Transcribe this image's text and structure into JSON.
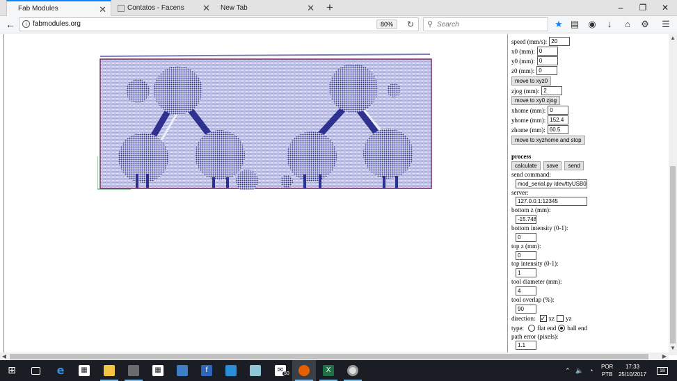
{
  "browser": {
    "tabs": [
      {
        "title": "Fab Modules",
        "active": true
      },
      {
        "title": "Contatos - Facens",
        "active": false
      },
      {
        "title": "New Tab",
        "active": false
      }
    ],
    "new_tab": "+",
    "window_controls": {
      "minimize": "–",
      "maximize": "❐",
      "close": "✕"
    },
    "url": "fabmodules.org",
    "zoom": "80%",
    "search_placeholder": "Search"
  },
  "panel": {
    "speed_label": "speed (mm/s):",
    "speed": "20",
    "x0_label": "x0 (mm):",
    "x0": "0",
    "y0_label": "y0 (mm):",
    "y0": "0",
    "z0_label": "z0 (mm):",
    "z0": "0",
    "move_xyz0": "move to xyz0",
    "zjog_label": "zjog (mm):",
    "zjog": "2",
    "move_xy0_zjog": "move to xy0 zjog",
    "xhome_label": "xhome (mm):",
    "xhome": "0",
    "yhome_label": "yhome (mm):",
    "yhome": "152.4",
    "zhome_label": "zhome (mm):",
    "zhome": "60.5",
    "move_xyzhome_stop": "move to xyzhome and stop",
    "process_heading": "process",
    "calculate": "calculate",
    "save": "save",
    "send": "send",
    "send_command_label": "send command:",
    "send_command": "mod_serial.py /dev/ttyUSB0",
    "server_label": "server:",
    "server": "127.0.0.1:12345",
    "bottom_z_label": "bottom z (mm):",
    "bottom_z": "-15.748",
    "bottom_intensity_label": "bottom intensity (0-1):",
    "bottom_intensity": "0",
    "top_z_label": "top z (mm):",
    "top_z": "0",
    "top_intensity_label": "top intensity (0-1):",
    "top_intensity": "1",
    "tool_diameter_label": "tool diameter (mm):",
    "tool_diameter": "4",
    "tool_overlap_label": "tool overlap (%):",
    "tool_overlap": "90",
    "direction_label": "direction:",
    "direction_xz": "xz",
    "direction_yz": "yz",
    "direction_xz_checked": true,
    "direction_yz_checked": false,
    "type_label": "type:",
    "type_flat": "flat end",
    "type_ball": "ball end",
    "type_selected": "ball end",
    "path_error_label": "path error (pixels):",
    "path_error": "1.1"
  },
  "taskbar": {
    "apps": [
      {
        "name": "start",
        "icon": "windows-icon"
      },
      {
        "name": "task-view",
        "icon": "task-view-icon"
      },
      {
        "name": "edge",
        "icon": "edge-icon"
      },
      {
        "name": "store",
        "icon": "store-icon"
      },
      {
        "name": "file-explorer",
        "icon": "folder-icon"
      },
      {
        "name": "app-5",
        "icon": "app-icon"
      },
      {
        "name": "calculator",
        "icon": "calculator-icon"
      },
      {
        "name": "app-7",
        "icon": "app-icon"
      },
      {
        "name": "app-8",
        "icon": "app-icon"
      },
      {
        "name": "app-9",
        "icon": "app-icon"
      },
      {
        "name": "app-10",
        "icon": "app-icon"
      },
      {
        "name": "mail",
        "icon": "mail-icon"
      },
      {
        "name": "firefox",
        "icon": "firefox-icon"
      },
      {
        "name": "excel",
        "icon": "excel-icon"
      },
      {
        "name": "chrome",
        "icon": "chrome-icon"
      }
    ],
    "mail_badge": "50",
    "language": "POR",
    "layout": "PTB",
    "time": "17:33",
    "date": "25/10/2017",
    "notifications": "18"
  },
  "colors": {
    "toolpath": "#3c3fa6",
    "toolpath_edge": "#c0182c",
    "accent": "#0a84ff"
  }
}
